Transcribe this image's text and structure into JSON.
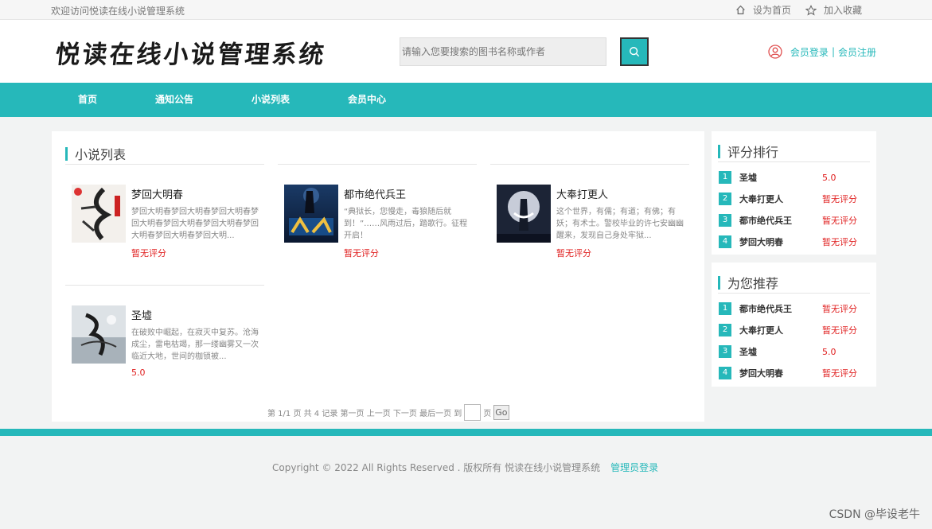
{
  "topbar": {
    "welcome": "欢迎访问悦读在线小说管理系统",
    "set_home": "设为首页",
    "add_fav": "加入收藏",
    "home_icon": "home-icon",
    "star_icon": "star-icon"
  },
  "header": {
    "logo": "悦读在线小说管理系统",
    "search_placeholder": "请输入您要搜索的图书名称或作者",
    "search_icon": "search-icon",
    "login": "会员登录",
    "sep": "|",
    "register": "会员注册",
    "user_icon": "user-icon"
  },
  "nav": [
    "首页",
    "通知公告",
    "小说列表",
    "会员中心"
  ],
  "main": {
    "title": "小说列表",
    "books": [
      {
        "title": "梦回大明春",
        "desc": "梦回大明春梦回大明春梦回大明春梦回大明春梦回大明春梦回大明春梦回大明春梦回大明春梦回大明...",
        "score": "暂无评分"
      },
      {
        "title": "都市绝代兵王",
        "desc": "“典狱长，您慢走，毒狼随后就到！”……风雨过后，踏歌行。征程开启！",
        "score": "暂无评分"
      },
      {
        "title": "大奉打更人",
        "desc": "这个世界，有儒；有道；有佛；有妖；有术士。警校毕业的许七安幽幽醒来，发现自己身处牢狱...",
        "score": "暂无评分"
      },
      {
        "title": "圣墟",
        "desc": "在破败中崛起，在寂灭中复苏。沧海成尘，雷电枯竭，那一缕幽雾又一次临近大地，世间的枷锁被...",
        "score": "5.0"
      }
    ],
    "pager": {
      "info": "第 1/1 页 共 4 记录 第一页 上一页 下一页 最后一页 到",
      "page_suffix": "页",
      "go": "Go"
    }
  },
  "side1": {
    "title": "评分排行",
    "items": [
      {
        "num": "1",
        "name": "圣墟",
        "score": "5.0"
      },
      {
        "num": "2",
        "name": "大奉打更人",
        "score": "暂无评分"
      },
      {
        "num": "3",
        "name": "都市绝代兵王",
        "score": "暂无评分"
      },
      {
        "num": "4",
        "name": "梦回大明春",
        "score": "暂无评分"
      }
    ]
  },
  "side2": {
    "title": "为您推荐",
    "items": [
      {
        "num": "1",
        "name": "都市绝代兵王",
        "score": "暂无评分"
      },
      {
        "num": "2",
        "name": "大奉打更人",
        "score": "暂无评分"
      },
      {
        "num": "3",
        "name": "圣墟",
        "score": "5.0"
      },
      {
        "num": "4",
        "name": "梦回大明春",
        "score": "暂无评分"
      }
    ]
  },
  "footer": {
    "copyright": "Copyright © 2022 All Rights Reserved . 版权所有  悦读在线小说管理系统",
    "admin_login": "管理员登录"
  },
  "watermark": "CSDN @毕设老牛",
  "colors": {
    "accent": "#26b8ba",
    "score_red": "#e02020"
  }
}
